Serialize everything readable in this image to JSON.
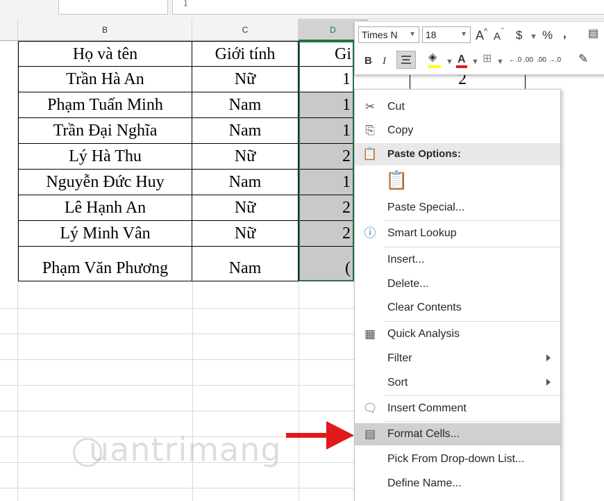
{
  "formula_bar": {
    "fx_text": "1"
  },
  "columns": [
    {
      "id": "b",
      "label": "B"
    },
    {
      "id": "c",
      "label": "C"
    },
    {
      "id": "d",
      "label": "D"
    }
  ],
  "table": {
    "headers": {
      "name": "Họ và tên",
      "gender": "Giới tính",
      "third": "Gi"
    },
    "rows": [
      {
        "name": "Trần Hà An",
        "gender": "Nữ",
        "d": "1"
      },
      {
        "name": "Phạm Tuấn Minh",
        "gender": "Nam",
        "d": "1"
      },
      {
        "name": "Trần Đại Nghĩa",
        "gender": "Nam",
        "d": "1"
      },
      {
        "name": "Lý Hà Thu",
        "gender": "Nữ",
        "d": "2"
      },
      {
        "name": "Nguyễn Đức Huy",
        "gender": "Nam",
        "d": "1"
      },
      {
        "name": "Lê Hạnh An",
        "gender": "Nữ",
        "d": "2"
      },
      {
        "name": "Lý Minh Vân",
        "gender": "Nữ",
        "d": "2"
      },
      {
        "name": "Phạm Văn Phương",
        "gender": "Nam",
        "d": "("
      }
    ],
    "visible_e_value": "2"
  },
  "mini_toolbar": {
    "font_name": "Times N",
    "font_size": "18",
    "bold": "B",
    "italic": "I",
    "font_color_letter": "A",
    "increase_font": "A",
    "decrease_font": "A",
    "currency": "$",
    "percent": "%",
    "comma": ",",
    "inc_decimal": "←.0 .00",
    "dec_decimal": ".00 →.0"
  },
  "context_menu": {
    "items": [
      {
        "id": "cut",
        "label": "Cut"
      },
      {
        "id": "copy",
        "label": "Copy"
      },
      {
        "id": "paste-options",
        "label": "Paste Options:"
      },
      {
        "id": "paste-special",
        "label": "Paste Special..."
      },
      {
        "id": "smart-lookup",
        "label": "Smart Lookup"
      },
      {
        "id": "insert",
        "label": "Insert..."
      },
      {
        "id": "delete",
        "label": "Delete..."
      },
      {
        "id": "clear-contents",
        "label": "Clear Contents"
      },
      {
        "id": "quick-analysis",
        "label": "Quick Analysis"
      },
      {
        "id": "filter",
        "label": "Filter"
      },
      {
        "id": "sort",
        "label": "Sort"
      },
      {
        "id": "insert-comment",
        "label": "Insert Comment"
      },
      {
        "id": "format-cells",
        "label": "Format Cells..."
      },
      {
        "id": "pick-from-list",
        "label": "Pick From Drop-down List..."
      },
      {
        "id": "define-name",
        "label": "Define Name..."
      }
    ]
  },
  "watermark": {
    "text": "uantrimang"
  },
  "colors": {
    "excel_green": "#217346",
    "highlight": "#d0d0d0",
    "arrow_red": "#e0191b"
  }
}
